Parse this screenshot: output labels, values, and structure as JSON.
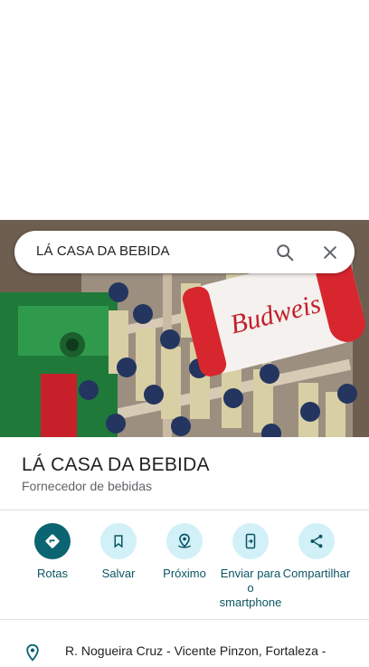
{
  "search": {
    "query": "LÁ CASA DA BEBIDA",
    "search_icon": "search-icon",
    "close_icon": "close-icon"
  },
  "place": {
    "name": "LÁ CASA DA BEBIDA",
    "category": "Fornecedor de bebidas",
    "photo_brand_text": "Budweis"
  },
  "actions": [
    {
      "label": "Rotas",
      "icon": "directions-icon"
    },
    {
      "label": "Salvar",
      "icon": "bookmark-icon"
    },
    {
      "label": "Próximo",
      "icon": "nearby-icon"
    },
    {
      "label": "Enviar para o smartphone",
      "icon": "send-to-phone-icon"
    },
    {
      "label": "Compartilhar",
      "icon": "share-icon"
    }
  ],
  "address": {
    "text": "R. Nogueira Cruz - Vicente Pinzon, Fortaleza -",
    "icon": "location-pin-icon"
  },
  "colors": {
    "primary": "#0b6471",
    "action_bg": "#d2f0f7",
    "action_text": "#0b5563"
  }
}
